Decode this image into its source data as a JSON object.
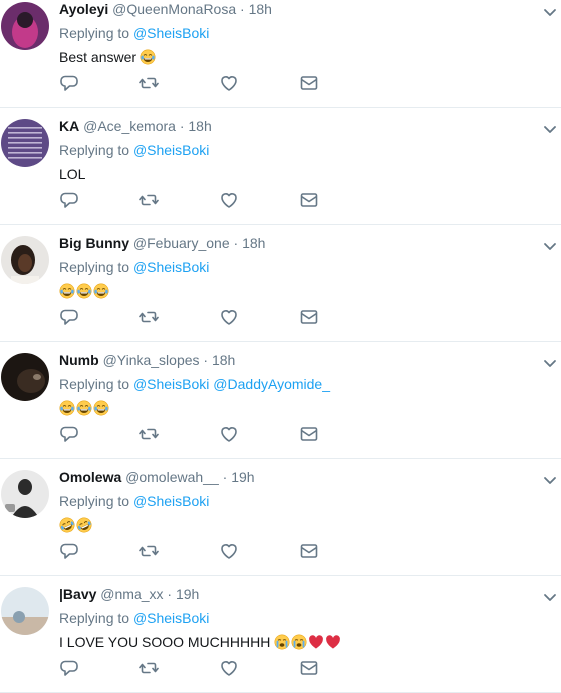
{
  "replies": [
    {
      "name": "Ayoleyi",
      "handle": "@QueenMonaRosa",
      "time": "18h",
      "replying_prefix": "Replying to",
      "mentions": [
        "@SheisBoki"
      ],
      "text": "Best answer",
      "emoji": [
        "joy"
      ],
      "avatar_colors": [
        "#6b2d6b",
        "#c23a8a",
        "#2a1a2a"
      ]
    },
    {
      "name": "KA",
      "handle": "@Ace_kemora",
      "time": "18h",
      "replying_prefix": "Replying to",
      "mentions": [
        "@SheisBoki"
      ],
      "text": "LOL",
      "emoji": [],
      "avatar_colors": [
        "#5e4a86",
        "#7a67a0",
        "#d8d0e8"
      ]
    },
    {
      "name": "Big Bunny",
      "handle": "@Febuary_one",
      "time": "18h",
      "replying_prefix": "Replying to",
      "mentions": [
        "@SheisBoki"
      ],
      "text": "",
      "emoji": [
        "joy",
        "joy",
        "joy"
      ],
      "avatar_colors": [
        "#e8e6e3",
        "#2a1e18",
        "#f4f1ec"
      ]
    },
    {
      "name": "Numb",
      "handle": "@Yinka_slopes",
      "time": "18h",
      "replying_prefix": "Replying to",
      "mentions": [
        "@SheisBoki",
        "@DaddyAyomide_"
      ],
      "text": "",
      "emoji": [
        "joy",
        "joy",
        "joy"
      ],
      "avatar_colors": [
        "#1c1612",
        "#3a2c22",
        "#8a7a6a"
      ]
    },
    {
      "name": "Omolewa",
      "handle": "@omolewah__",
      "time": "19h",
      "replying_prefix": "Replying to",
      "mentions": [
        "@SheisBoki"
      ],
      "text": "",
      "emoji": [
        "rofl",
        "rofl"
      ],
      "avatar_colors": [
        "#e9e9e9",
        "#2b2b2b",
        "#9a9a9a"
      ]
    },
    {
      "name": "|Bavy",
      "handle": "@nma_xx",
      "time": "19h",
      "replying_prefix": "Replying to",
      "mentions": [
        "@SheisBoki"
      ],
      "text": "I LOVE YOU SOOO MUCHHHHH",
      "emoji": [
        "sob",
        "sob",
        "heart",
        "heart"
      ],
      "avatar_colors": [
        "#dfe8ee",
        "#c9b8a6",
        "#8aa0b0"
      ]
    }
  ],
  "icons": {
    "reply": "reply-icon",
    "retweet": "retweet-icon",
    "like": "heart-icon",
    "dm": "envelope-icon",
    "caret": "chevron-down-icon"
  },
  "colors": {
    "accent": "#1da1f2",
    "muted": "#657786",
    "icon": "#657786",
    "divider": "#e6ecf0"
  }
}
